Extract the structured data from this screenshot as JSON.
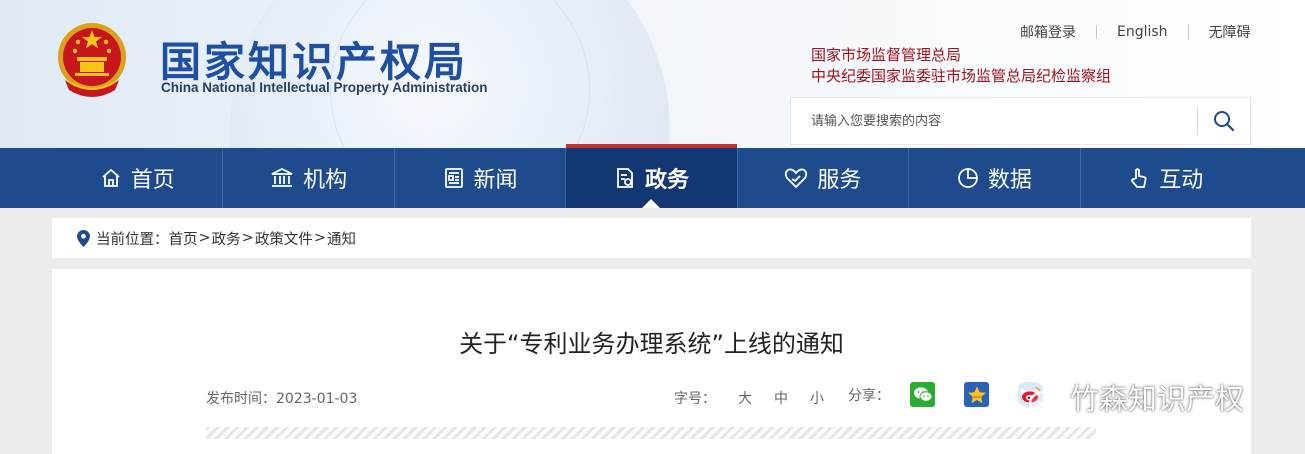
{
  "header": {
    "logo_cn": "国家知识产权局",
    "logo_en": "China National Intellectual Property Administration",
    "top_links": [
      "邮箱登录",
      "English",
      "无障碍"
    ],
    "org_links": [
      "国家市场监督管理总局",
      "中央纪委国家监委驻市场监管总局纪检监察组"
    ],
    "search_placeholder": "请输入您要搜索的内容"
  },
  "nav": {
    "items": [
      {
        "label": "首页",
        "icon": "home-icon"
      },
      {
        "label": "机构",
        "icon": "institution-icon"
      },
      {
        "label": "新闻",
        "icon": "news-icon"
      },
      {
        "label": "政务",
        "icon": "document-icon",
        "active": true
      },
      {
        "label": "服务",
        "icon": "service-icon"
      },
      {
        "label": "数据",
        "icon": "pie-chart-icon"
      },
      {
        "label": "互动",
        "icon": "hand-icon"
      }
    ]
  },
  "breadcrumb": {
    "prefix": "当前位置：",
    "items": [
      "首页",
      "政务",
      "政策文件",
      "通知"
    ],
    "separator": ">"
  },
  "article": {
    "title": "关于“专利业务办理系统”上线的通知",
    "publish_label": "发布时间：",
    "publish_date": "2023-01-03",
    "font_label": "字号：",
    "font_sizes": [
      "大",
      "中",
      "小"
    ],
    "share_label": "分享："
  },
  "watermark": {
    "text": "竹森知识产权"
  },
  "colors": {
    "nav_bg": "#1e4a8e",
    "nav_active": "#133772",
    "accent_red": "#c0332f",
    "logo_blue": "#1f4fa3",
    "org_red": "#a0121b"
  }
}
